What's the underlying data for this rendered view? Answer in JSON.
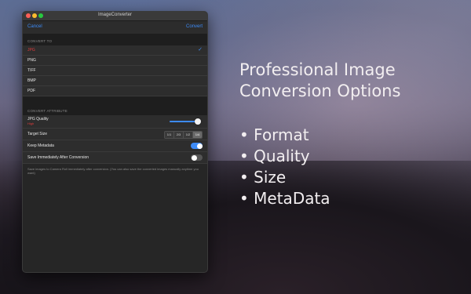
{
  "window": {
    "title": "ImageConverter",
    "toolbar": {
      "cancel_label": "Cancel",
      "convert_label": "Convert"
    }
  },
  "convert_to": {
    "header": "CONVERT TO",
    "selected": "JPG",
    "formats": [
      {
        "label": "JPG"
      },
      {
        "label": "PNG"
      },
      {
        "label": "TIFF"
      },
      {
        "label": "BMP"
      },
      {
        "label": "PDF"
      }
    ]
  },
  "convert_attribute": {
    "header": "CONVERT ATTRIBUTE",
    "jpg_quality": {
      "label": "JPG Quality",
      "value_label": "High",
      "value": 0.9
    },
    "target_size": {
      "label": "Target Size",
      "options": [
        "1/1",
        "2/3",
        "1/2",
        "1/4"
      ],
      "selected": "1/4"
    },
    "keep_metadata": {
      "label": "Keep Metadata",
      "on": true
    },
    "save_immediately": {
      "label": "Save Immediately After Conversion",
      "on": false
    },
    "note": "Save images to Camera Roll immediately after conversion. (You can also save the converted images manually anytime you want)"
  },
  "promo": {
    "title_line1": "Professional Image",
    "title_line2": "Conversion Options",
    "bullets": [
      "• Format",
      "• Quality",
      "• Size",
      "• MetaData"
    ]
  },
  "colors": {
    "accent": "#3d8bf7",
    "selected_text": "#e13c3c"
  }
}
